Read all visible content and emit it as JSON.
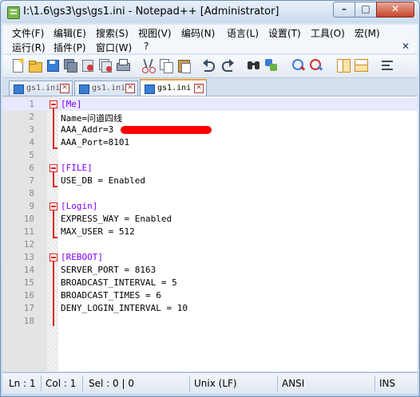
{
  "window": {
    "title": "I:\\1.6\\gs3\\gs\\gs1.ini - Notepad++ [Administrator]",
    "min_glyph": "–",
    "max_glyph": "□",
    "close_glyph": "✕"
  },
  "menu": {
    "row1": [
      "文件(F)",
      "编辑(E)",
      "搜索(S)",
      "视图(V)",
      "编码(N)",
      "语言(L)",
      "设置(T)",
      "工具(O)",
      "宏(M)"
    ],
    "row2": [
      "运行(R)",
      "插件(P)",
      "窗口(W)",
      "?"
    ],
    "close_glyph": "✕"
  },
  "toolbar": {
    "icons": [
      "new-file-icon",
      "open-file-icon",
      "save-icon",
      "save-all-icon",
      "close-icon",
      "close-all-icon",
      "print-icon",
      "cut-icon",
      "copy-icon",
      "paste-icon",
      "undo-icon",
      "redo-icon",
      "find-icon",
      "replace-icon",
      "zoom-in-icon",
      "zoom-out-icon",
      "sync-v-icon",
      "sync-h-icon",
      "word-wrap-icon"
    ]
  },
  "tabs": [
    {
      "label": "gs1.ini",
      "active": false
    },
    {
      "label": "gs1.ini",
      "active": false
    },
    {
      "label": "gs1.ini",
      "active": true
    }
  ],
  "editor": {
    "lines": [
      {
        "n": "1",
        "text": "[Me]"
      },
      {
        "n": "2",
        "text": "Name=问道四线"
      },
      {
        "n": "3",
        "text": "AAA_Addr=3"
      },
      {
        "n": "4",
        "text": "AAA_Port=8101"
      },
      {
        "n": "5",
        "text": ""
      },
      {
        "n": "6",
        "text": "[FILE]"
      },
      {
        "n": "7",
        "text": "USE_DB = Enabled"
      },
      {
        "n": "8",
        "text": ""
      },
      {
        "n": "9",
        "text": "[Login]"
      },
      {
        "n": "10",
        "text": "EXPRESS_WAY = Enabled"
      },
      {
        "n": "11",
        "text": "MAX_USER = 512"
      },
      {
        "n": "12",
        "text": ""
      },
      {
        "n": "13",
        "text": "[REBOOT]"
      },
      {
        "n": "14",
        "text": "SERVER_PORT = 8163"
      },
      {
        "n": "15",
        "text": "BROADCAST_INTERVAL = 5"
      },
      {
        "n": "16",
        "text": "BROADCAST_TIMES = 6"
      },
      {
        "n": "17",
        "text": "DENY_LOGIN_INTERVAL = 10"
      },
      {
        "n": "18",
        "text": ""
      }
    ]
  },
  "status": {
    "ln": "Ln : 1",
    "col": "Col : 1",
    "sel": "Sel : 0 | 0",
    "eol": "Unix (LF)",
    "encoding": "ANSI",
    "mode": "INS"
  }
}
